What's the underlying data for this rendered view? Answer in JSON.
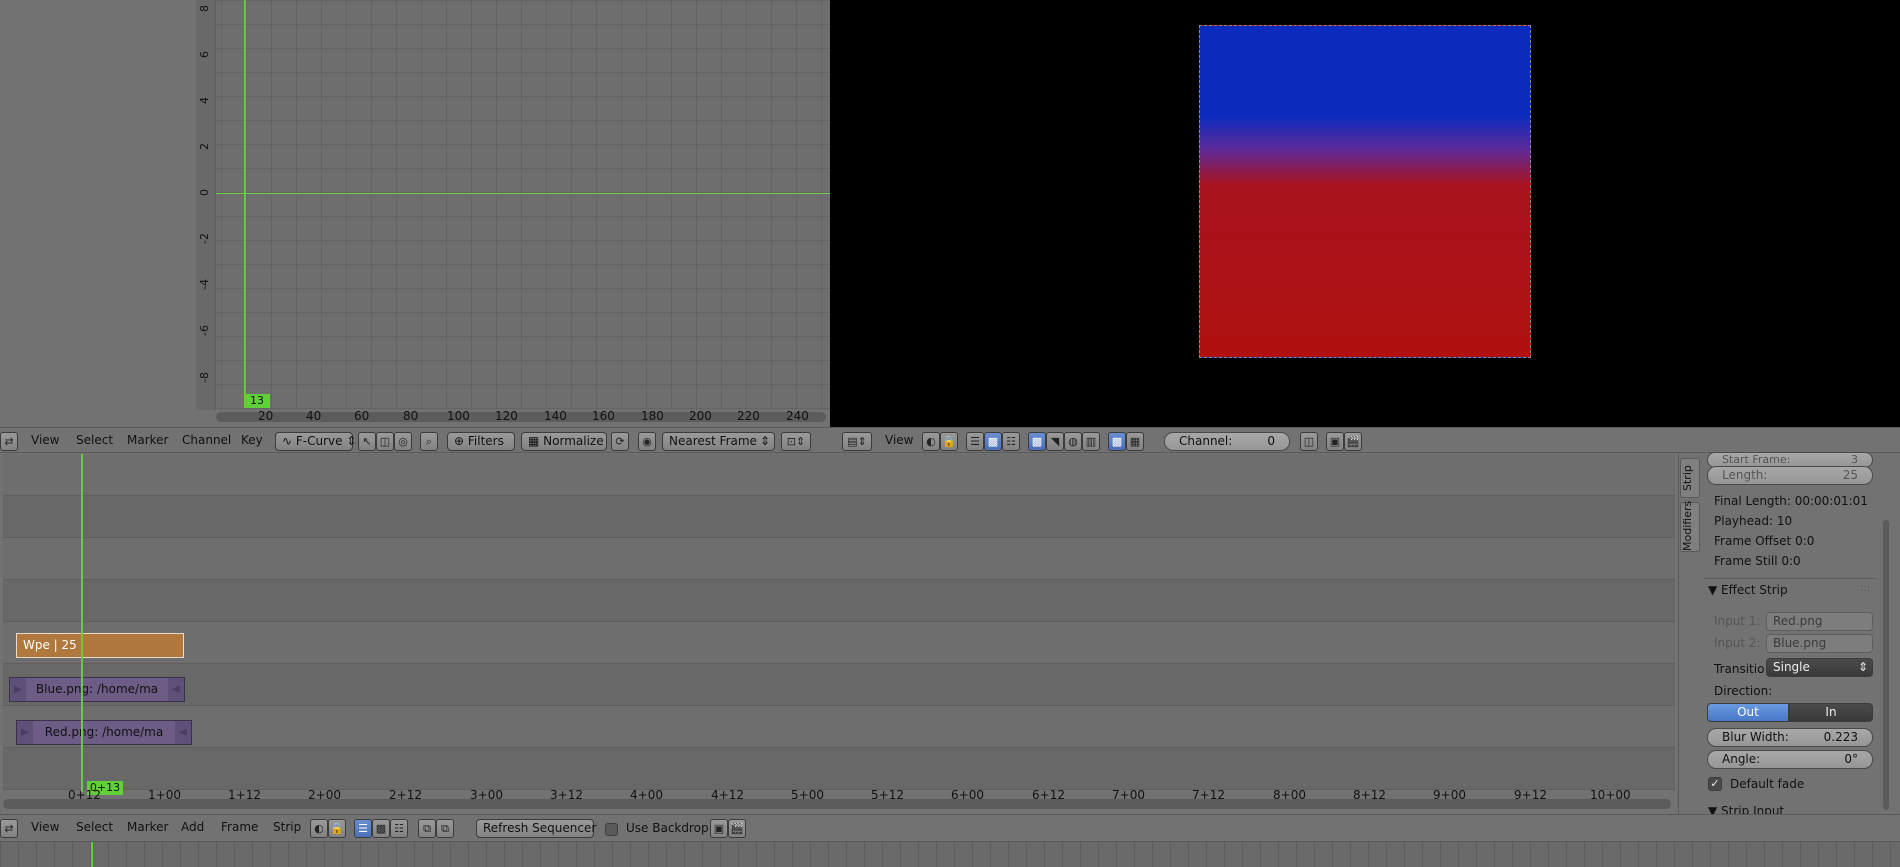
{
  "graph_editor": {
    "y_ticks": [
      "8",
      "6",
      "4",
      "2",
      "0",
      "-2",
      "-4",
      "-6",
      "-8"
    ],
    "x_ticks": [
      "20",
      "40",
      "60",
      "80",
      "100",
      "120",
      "140",
      "160",
      "180",
      "200",
      "220",
      "240"
    ],
    "current_frame": "13",
    "header": {
      "menus": [
        "View",
        "Select",
        "Marker",
        "Channel",
        "Key"
      ],
      "mode": "F-Curve",
      "filters_label": "Filters",
      "normalize_label": "Normalize",
      "snap_mode": "Nearest Frame"
    }
  },
  "preview": {
    "header": {
      "view_menu": "View",
      "channel_label": "Channel:",
      "channel_value": "0"
    }
  },
  "sequencer": {
    "strips": {
      "wipe": "Wpe | 25",
      "blue": "Blue.png: /home/ma",
      "red": "Red.png: /home/ma"
    },
    "playhead_label": "0+13",
    "timecodes": [
      "0+12",
      "1+00",
      "1+12",
      "2+00",
      "2+12",
      "3+00",
      "3+12",
      "4+00",
      "4+12",
      "5+00",
      "5+12",
      "6+00",
      "6+12",
      "7+00",
      "7+12",
      "8+00",
      "8+12",
      "9+00",
      "9+12",
      "10+00"
    ]
  },
  "properties": {
    "tabs": {
      "strip": "Strip",
      "modifiers": "Modifiers"
    },
    "start_frame_label": "Start Frame:",
    "start_frame_value": "3",
    "length_label": "Length:",
    "length_value": "25",
    "final_length": "Final Length: 00:00:01:01",
    "playhead": "Playhead: 10",
    "frame_offset": "Frame Offset 0:0",
    "frame_still": "Frame Still 0:0",
    "effect_strip_title": "Effect Strip",
    "input1_label": "Input 1:",
    "input1_value": "Red.png",
    "input2_label": "Input 2:",
    "input2_value": "Blue.png",
    "transition_label": "Transitio",
    "transition_value": "Single",
    "direction_label": "Direction:",
    "direction_out": "Out",
    "direction_in": "In",
    "blur_width_label": "Blur Width:",
    "blur_width_value": "0.223",
    "angle_label": "Angle:",
    "angle_value": "0°",
    "default_fade_label": "Default fade",
    "strip_input_title": "Strip Input"
  },
  "timeline_header": {
    "menus": [
      "View",
      "Select",
      "Marker",
      "Add",
      "Frame",
      "Strip"
    ],
    "refresh_label": "Refresh Sequencer",
    "use_backdrop_label": "Use Backdrop"
  }
}
